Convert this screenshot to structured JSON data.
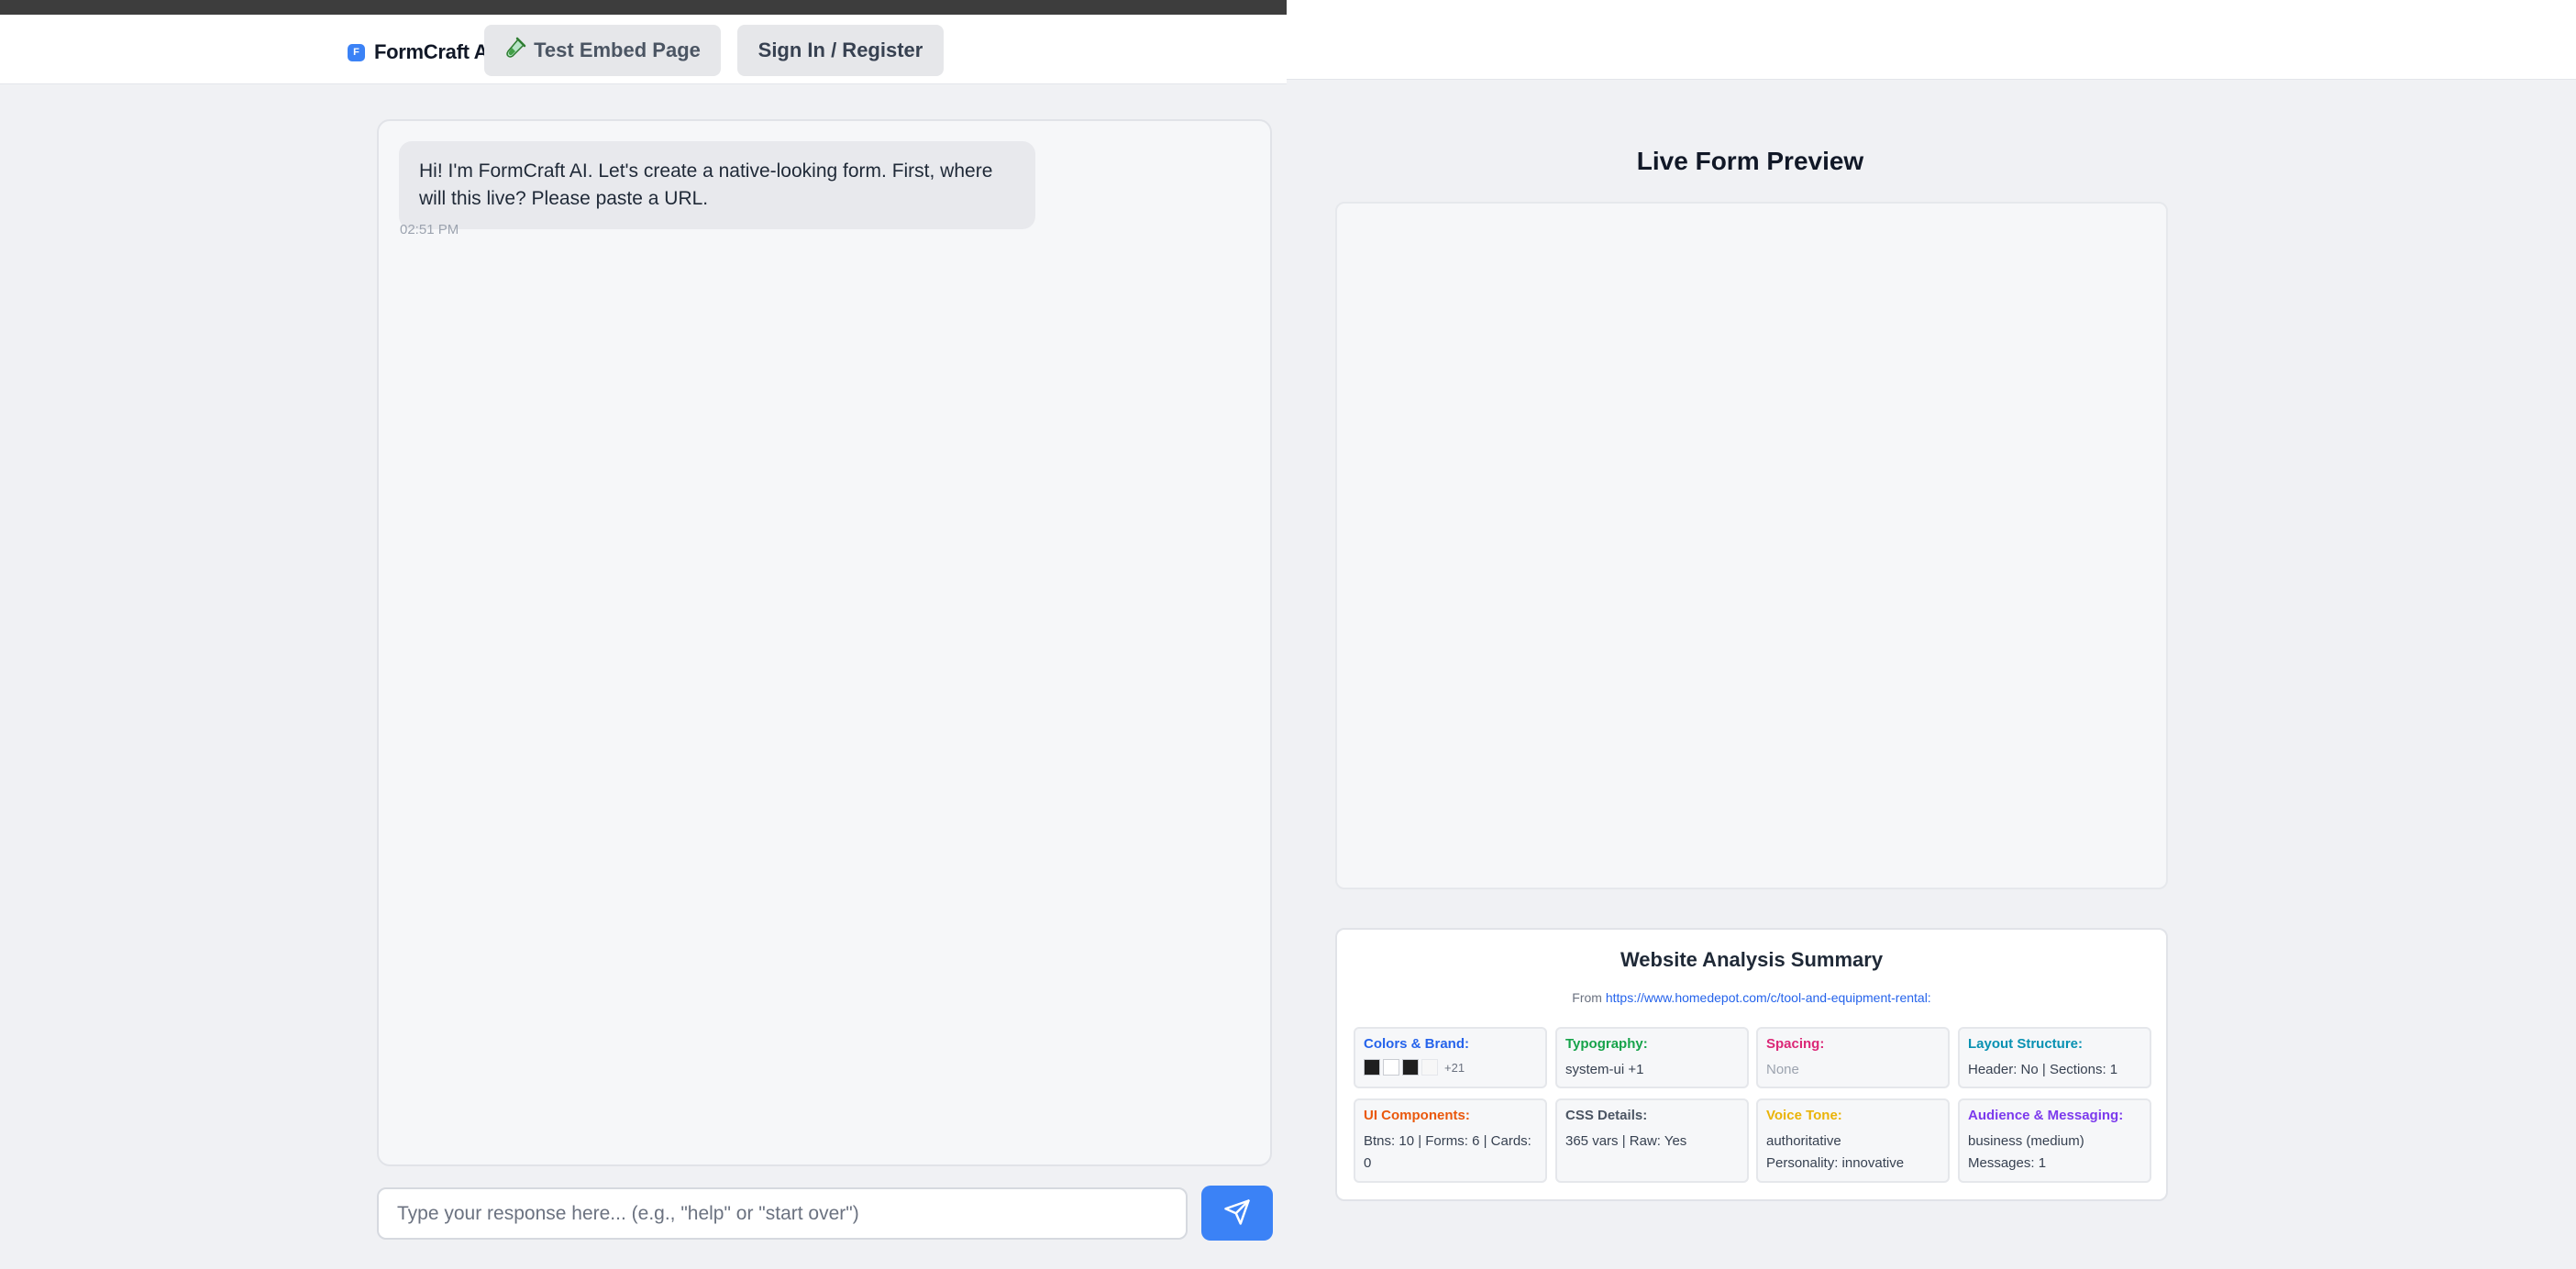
{
  "header": {
    "logo_initial": "F",
    "logo_text": "FormCraft AI",
    "embed_button": "Test Embed Page",
    "signin_button": "Sign In / Register"
  },
  "chat": {
    "message": "Hi! I'm FormCraft AI. Let's create a native-looking form. First, where will this live? Please paste a URL.",
    "timestamp": "02:51 PM",
    "input_placeholder": "Type your response here... (e.g., \"help\" or \"start over\")",
    "input_value": ""
  },
  "preview": {
    "title": "Live Form Preview"
  },
  "analysis": {
    "title": "Website Analysis Summary",
    "from_label": "From",
    "source_url": "https://www.homedepot.com/c/tool-and-equipment-rental:",
    "colors": {
      "title": "Colors & Brand:",
      "swatches": [
        "#1f1f1f",
        "#ffffff",
        "#1f1f1f",
        "#f7f7f7"
      ],
      "more": "+21",
      "title_color": "#2563eb"
    },
    "typography": {
      "title": "Typography:",
      "value": "system-ui +1",
      "title_color": "#16a34a"
    },
    "spacing": {
      "title": "Spacing:",
      "value": "None",
      "title_color": "#db2777"
    },
    "layout": {
      "title": "Layout Structure:",
      "value": "Header: No | Sections: 1",
      "title_color": "#0891b2"
    },
    "ui_components": {
      "title": "UI Components:",
      "line1": "Btns: 10 | Forms: 6 | Cards:",
      "line2": "0",
      "title_color": "#ea580c"
    },
    "css": {
      "title": "CSS Details:",
      "value": "365 vars | Raw: Yes",
      "title_color": "#4b5563"
    },
    "voice": {
      "title": "Voice Tone:",
      "line1": "authoritative",
      "line2": "Personality: innovative",
      "title_color": "#eab308"
    },
    "audience": {
      "title": "Audience & Messaging:",
      "line1": "business (medium)",
      "line2": "Messages: 1",
      "title_color": "#7c3aed"
    }
  }
}
